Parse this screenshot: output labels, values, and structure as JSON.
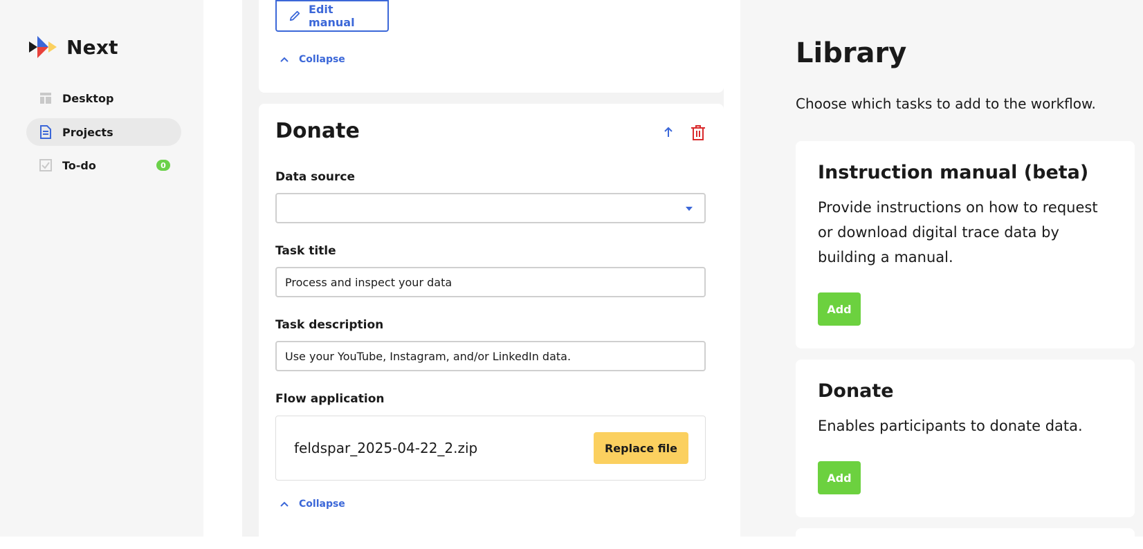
{
  "app": {
    "name": "Next"
  },
  "sidebar": {
    "items": [
      {
        "label": "Desktop",
        "icon": "desktop-icon"
      },
      {
        "label": "Projects",
        "icon": "document-icon",
        "active": true
      },
      {
        "label": "To-do",
        "icon": "checkbox-icon",
        "badge": "0"
      }
    ]
  },
  "manual_card": {
    "edit_label": "Edit manual",
    "collapse_label": "Collapse"
  },
  "donate_card": {
    "title": "Donate",
    "data_source": {
      "label": "Data source",
      "value": ""
    },
    "task_title": {
      "label": "Task title",
      "value": "Process and inspect your data"
    },
    "task_description": {
      "label": "Task description",
      "value": "Use your YouTube, Instagram, and/or LinkedIn data."
    },
    "flow_application": {
      "label": "Flow application",
      "file_name": "feldspar_2025-04-22_2.zip",
      "replace_label": "Replace file"
    },
    "collapse_label": "Collapse"
  },
  "library": {
    "title": "Library",
    "description": "Choose which tasks to add to the workflow.",
    "items": [
      {
        "title": "Instruction manual (beta)",
        "description": "Provide instructions on how to request or download digital trace data by building a manual.",
        "add_label": "Add"
      },
      {
        "title": "Donate",
        "description": "Enables participants to donate data.",
        "add_label": "Add"
      }
    ]
  },
  "colors": {
    "accent_blue": "#3b67d8",
    "delete_red": "#d9292b",
    "add_green": "#6cd13f",
    "replace_yellow": "#fbd05f"
  }
}
